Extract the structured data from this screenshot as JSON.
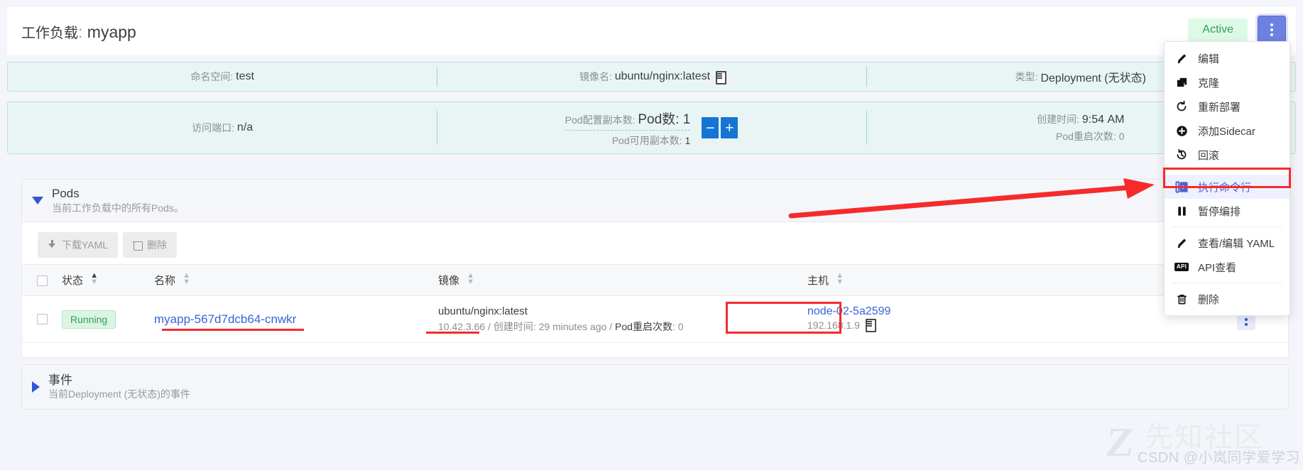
{
  "header": {
    "title_label": "工作负载",
    "title_sep": ": ",
    "title_value": "myapp",
    "status_badge": "Active",
    "kebab_name": "actions-menu-button"
  },
  "info_row1": [
    {
      "label": "命名空间",
      "value": "test"
    },
    {
      "label": "镜像名",
      "value": "ubuntu/nginx:latest",
      "icon": "copy-icon"
    },
    {
      "label": "类型",
      "value": "Deployment (无状态)"
    }
  ],
  "info_row2": {
    "port": {
      "label": "访问端口",
      "value": "n/a"
    },
    "replicas": {
      "configured_label": "Pod配置副本数",
      "pod_count_label": "Pod数",
      "pod_count_value": "1",
      "available_label": "Pod可用副本数",
      "available_value": "1",
      "minus": "−",
      "plus": "+"
    },
    "created": {
      "label": "创建时间",
      "value": "9:54 AM",
      "restart_label": "Pod重启次数",
      "restart_value": "0"
    }
  },
  "pods_section": {
    "title": "Pods",
    "subtitle": "当前工作负载中的所有Pods。",
    "toolbar": {
      "download_yaml": "下载YAML",
      "delete": "删除"
    },
    "columns": [
      "状态",
      "名称",
      "镜像",
      "主机"
    ],
    "rows": [
      {
        "status": "Running",
        "name": "myapp-567d7dcb64-cnwkr",
        "image_main": "ubuntu/nginx:latest",
        "image_ip": "10.42.3.66",
        "image_sep1": " / ",
        "image_created_label": "创建时间",
        "image_created_value": "29 minutes ago",
        "image_sep2": " / ",
        "image_restart_label": "Pod重启次数",
        "image_restart_value": "0",
        "host_name": "node-02-5a2599",
        "host_ip": "192.168.1.9"
      }
    ]
  },
  "events_section": {
    "title": "事件",
    "subtitle": "当前Deployment (无状态)的事件"
  },
  "menu": {
    "items": [
      {
        "label": "编辑",
        "icon": "pencil-icon",
        "highlight": false,
        "sep_after": false
      },
      {
        "label": "克隆",
        "icon": "clone-icon",
        "highlight": false,
        "sep_after": false
      },
      {
        "label": "重新部署",
        "icon": "redeploy-icon",
        "highlight": false,
        "sep_after": false
      },
      {
        "label": "添加Sidecar",
        "icon": "plus-circle-icon",
        "highlight": false,
        "sep_after": false
      },
      {
        "label": "回滚",
        "icon": "rollback-icon",
        "highlight": false,
        "sep_after": true
      },
      {
        "label": "执行命令行",
        "icon": "terminal-icon",
        "highlight": true,
        "sep_after": false
      },
      {
        "label": "暂停编排",
        "icon": "pause-icon",
        "highlight": false,
        "sep_after": true
      },
      {
        "label": "查看/编辑 YAML",
        "icon": "pencil-icon",
        "highlight": false,
        "sep_after": false
      },
      {
        "label": "API查看",
        "icon": "api-icon",
        "highlight": false,
        "sep_after": true
      },
      {
        "label": "删除",
        "icon": "trash-icon",
        "highlight": false,
        "sep_after": false
      }
    ]
  },
  "watermark": {
    "logo": "Z",
    "site": "先知社区",
    "credit": "CSDN @小岚同学爱学习"
  },
  "colors": {
    "accent_blue": "#2f57d6",
    "badge_green": "#2e9e5b",
    "strip_bg": "#e8f5f4",
    "annotation_red": "#f52b2b"
  }
}
